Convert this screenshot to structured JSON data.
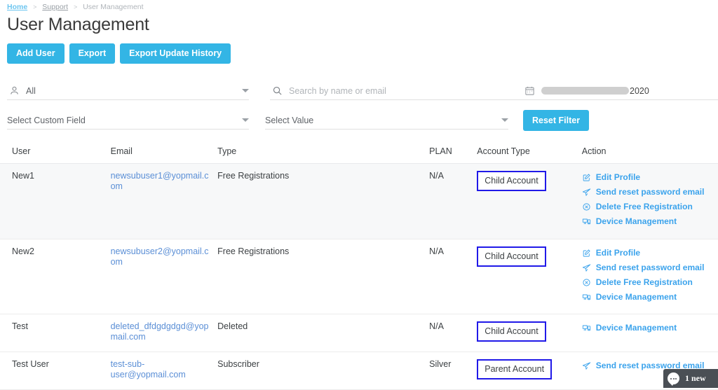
{
  "breadcrumb": {
    "home": "Home",
    "separator": ">",
    "middle": "Support",
    "current": "User Management"
  },
  "page": {
    "title": "User Management"
  },
  "toolbar": {
    "add_user_label": "Add User",
    "export_label": "Export",
    "export_update_history_label": "Export Update History",
    "accent_color": "#33b5e5"
  },
  "filters": {
    "user_type": {
      "value": "All",
      "icon": "person-icon"
    },
    "custom_field": {
      "value": "Select Custom Field"
    },
    "search": {
      "placeholder": "Search by name or email",
      "value": "",
      "icon": "search-icon"
    },
    "select_value": {
      "value": "Select Value"
    },
    "date_range": {
      "icon": "calendar-icon",
      "redacted": true,
      "visible_text": "2020"
    },
    "reset_label": "Reset Filter"
  },
  "table": {
    "columns": [
      "User",
      "Email",
      "Type",
      "PLAN",
      "Account Type",
      "Action"
    ],
    "rows": [
      {
        "user": "New1",
        "email": "newsubuser1@yopmail.com",
        "type": "Free Registrations",
        "plan": "N/A",
        "account_type": "Child Account",
        "highlight": true,
        "shaded": true,
        "actions": [
          {
            "label": "Edit Profile",
            "icon": "edit-profile-icon"
          },
          {
            "label": "Send reset password email",
            "icon": "send-email-icon"
          },
          {
            "label": "Delete Free Registration",
            "icon": "delete-circle-icon"
          },
          {
            "label": "Device Management",
            "icon": "device-icon"
          }
        ]
      },
      {
        "user": "New2",
        "email": "newsubuser2@yopmail.com",
        "type": "Free Registrations",
        "plan": "N/A",
        "account_type": "Child Account",
        "highlight": true,
        "shaded": false,
        "actions": [
          {
            "label": "Edit Profile",
            "icon": "edit-profile-icon"
          },
          {
            "label": "Send reset password email",
            "icon": "send-email-icon"
          },
          {
            "label": "Delete Free Registration",
            "icon": "delete-circle-icon"
          },
          {
            "label": "Device Management",
            "icon": "device-icon"
          }
        ]
      },
      {
        "user": "Test",
        "email": "deleted_dfdgdgdgd@yopmail.com",
        "type": "Deleted",
        "plan": "N/A",
        "account_type": "Child Account",
        "highlight": true,
        "shaded": false,
        "actions": [
          {
            "label": "Device Management",
            "icon": "device-icon"
          }
        ]
      },
      {
        "user": "Test User",
        "email": "test-sub-user@yopmail.com",
        "type": "Subscriber",
        "plan": "Silver",
        "account_type": "Parent Account",
        "highlight": true,
        "shaded": false,
        "actions": [
          {
            "label": "Send reset password email",
            "icon": "send-email-icon"
          }
        ]
      }
    ],
    "highlight_color": "#2019e8"
  },
  "chat_widget": {
    "label": "1 new",
    "icon": "chat-bubble-icon",
    "background": "#4a4f55"
  }
}
